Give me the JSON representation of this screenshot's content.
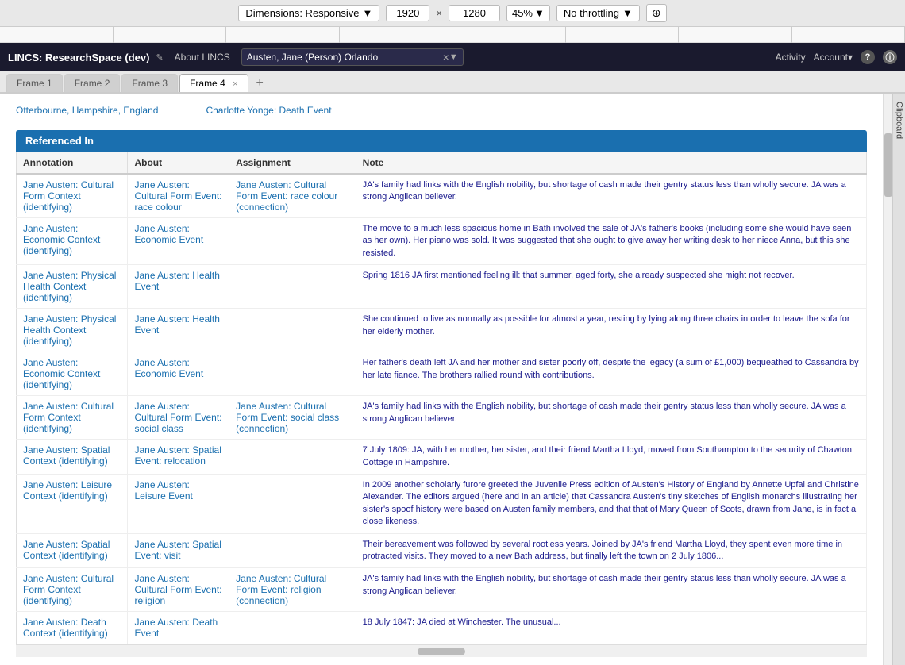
{
  "toolbar": {
    "dimensions_label": "Dimensions: Responsive",
    "dimensions_arrow": "▼",
    "width_value": "1920",
    "cross": "×",
    "height_value": "1280",
    "zoom_label": "45%",
    "zoom_arrow": "▼",
    "throttle_label": "No throttling",
    "throttle_arrow": "▼",
    "rotate_icon": "⊕"
  },
  "nav": {
    "logo": "LINCS: ResearchSpace (dev)",
    "edit_icon": "✎",
    "about_label": "About LINCS",
    "search_value": "Austen, Jane (Person) Orlando",
    "clear_icon": "×",
    "dropdown_icon": "▼",
    "activity_label": "Activity",
    "account_label": "Account▾",
    "help_icon": "?",
    "info_icon": "ⓘ"
  },
  "tabs": [
    {
      "label": "Frame 1",
      "active": false,
      "closeable": false
    },
    {
      "label": "Frame 2",
      "active": false,
      "closeable": false
    },
    {
      "label": "Frame 3",
      "active": false,
      "closeable": false
    },
    {
      "label": "Frame 4",
      "active": true,
      "closeable": true
    }
  ],
  "tabs_add": "+",
  "clipboard_label": "Clipboard",
  "location": {
    "part1": "Otterbourne, Hampshire, England",
    "separator": "     ",
    "part2": "Charlotte Yonge: Death Event"
  },
  "referenced_in": {
    "header": "Referenced In",
    "columns": [
      "Annotation",
      "About",
      "Assignment",
      "Note"
    ],
    "rows": [
      {
        "annotation": "Jane Austen: Cultural Form Context (identifying)",
        "about": "Jane Austen: Cultural Form Event: race colour",
        "assignment": "Jane Austen: Cultural Form Event: race colour (connection)",
        "note": "JA's family had links with the English nobility, but shortage of cash made their gentry status less than wholly secure. JA was a strong Anglican believer."
      },
      {
        "annotation": "Jane Austen: Economic Context (identifying)",
        "about": "Jane Austen: Economic Event",
        "assignment": "",
        "note": "The move to a much less spacious home in Bath involved the sale of JA's father's books (including some she would have seen as her own). Her piano was sold. It was suggested that she ought to give away her writing desk to her niece Anna, but this she resisted."
      },
      {
        "annotation": "Jane Austen: Physical Health Context (identifying)",
        "about": "Jane Austen: Health Event",
        "assignment": "",
        "note": "Spring 1816 JA first mentioned feeling ill: that summer, aged forty, she already suspected she might not recover."
      },
      {
        "annotation": "Jane Austen: Physical Health Context (identifying)",
        "about": "Jane Austen: Health Event",
        "assignment": "",
        "note": "She continued to live as normally as possible for almost a year, resting by lying along three chairs in order to leave the sofa for her elderly mother."
      },
      {
        "annotation": "Jane Austen: Economic Context (identifying)",
        "about": "Jane Austen: Economic Event",
        "assignment": "",
        "note": "Her father's death left JA and her mother and sister poorly off, despite the legacy (a sum of £1,000) bequeathed to Cassandra by her late fiance. The brothers rallied round with contributions."
      },
      {
        "annotation": "Jane Austen: Cultural Form Context (identifying)",
        "about": "Jane Austen: Cultural Form Event: social class",
        "assignment": "Jane Austen: Cultural Form Event: social class (connection)",
        "note": "JA's family had links with the English nobility, but shortage of cash made their gentry status less than wholly secure. JA was a strong Anglican believer."
      },
      {
        "annotation": "Jane Austen: Spatial Context (identifying)",
        "about": "Jane Austen: Spatial Event: relocation",
        "assignment": "",
        "note": "7 July 1809: JA, with her mother, her sister, and their friend Martha Lloyd, moved from Southampton to the security of Chawton Cottage in Hampshire."
      },
      {
        "annotation": "Jane Austen: Leisure Context (identifying)",
        "about": "Jane Austen: Leisure Event",
        "assignment": "",
        "note": "In 2009 another scholarly furore greeted the Juvenile Press edition of Austen's History of England by Annette Upfal and Christine Alexander. The editors argued (here and in an article) that Cassandra Austen's tiny sketches of English monarchs illustrating her sister's spoof history were based on Austen family members, and that that of Mary Queen of Scots, drawn from Jane, is in fact a close likeness."
      },
      {
        "annotation": "Jane Austen: Spatial Context (identifying)",
        "about": "Jane Austen: Spatial Event: visit",
        "assignment": "",
        "note": "Their bereavement was followed by several rootless years. Joined by JA's friend Martha Lloyd, they spent even more time in protracted visits. They moved to a new Bath address, but finally left the town on 2 July 1806..."
      },
      {
        "annotation": "Jane Austen: Cultural Form Context (identifying)",
        "about": "Jane Austen: Cultural Form Event: religion",
        "assignment": "Jane Austen: Cultural Form Event: religion (connection)",
        "note": "JA's family had links with the English nobility, but shortage of cash made their gentry status less than wholly secure. JA was a strong Anglican believer."
      },
      {
        "annotation": "Jane Austen: Death Context (identifying)",
        "about": "Jane Austen: Death Event",
        "assignment": "",
        "note": "18 July 1847: JA died at Winchester. The unusual..."
      }
    ]
  }
}
